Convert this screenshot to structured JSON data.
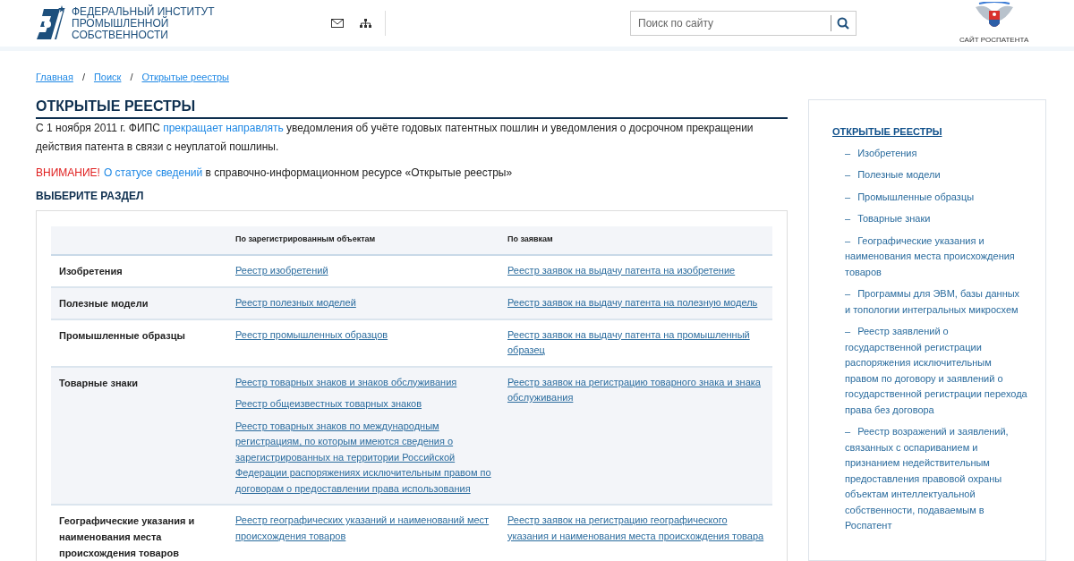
{
  "header": {
    "org_name": "ФЕДЕРАЛЬНЫЙ ИНСТИТУТ ПРОМЫШЛЕННОЙ СОБСТВЕННОСТИ",
    "search": {
      "placeholder": "Поиск по сайту"
    },
    "partner_link": "САЙТ РОСПАТЕНТА"
  },
  "breadcrumbs": [
    {
      "label": "Главная"
    },
    {
      "label": "Поиск"
    },
    {
      "label": "Открытые реестры"
    }
  ],
  "breadcrumb_separator": "/",
  "title": "ОТКРЫТЫЕ РЕЕСТРЫ",
  "notices": [
    [
      {
        "kind": "text",
        "text": "С 1 ноября 2011 г. ФИПС "
      },
      {
        "kind": "link",
        "text": "прекращает направлять"
      },
      {
        "kind": "text",
        "text": " уведомления об учёте годовых патентных пошлин и уведомления о досрочном прекращении действия патента в связи с неуплатой пошлины."
      }
    ],
    [
      {
        "kind": "alert",
        "text": "ВНИМАНИЕ!"
      },
      {
        "kind": "link",
        "text": "О статусе сведений"
      },
      {
        "kind": "text",
        "text": " в справочно-информационном ресурсе «Открытые реестры»"
      }
    ]
  ],
  "section_heading": "ВЫБЕРИТЕ РАЗДЕЛ",
  "table": {
    "columns": [
      "По зарегистрированным объектам",
      "По заявкам"
    ],
    "rows": [
      {
        "category": "Изобретения",
        "registered": [
          "Реестр изобретений"
        ],
        "applications": [
          "Реестр заявок на выдачу патента на изобретение"
        ]
      },
      {
        "category": "Полезные модели",
        "registered": [
          "Реестр полезных моделей"
        ],
        "applications": [
          "Реестр заявок на выдачу патента на полезную модель"
        ]
      },
      {
        "category": "Промышленные образцы",
        "registered": [
          "Реестр промышленных образцов"
        ],
        "applications": [
          "Реестр заявок на выдачу патента на промышленный образец"
        ]
      },
      {
        "category": "Товарные знаки",
        "registered": [
          "Реестр товарных знаков и знаков обслуживания",
          "Реестр общеизвестных товарных знаков",
          "Реестр товарных знаков по международным регистрациям, по которым имеются сведения о зарегистрированных на территории Российской Федерации распоряжениях исключительным правом по договорам о предоставлении права использования"
        ],
        "applications": [
          "Реестр заявок на регистрацию товарного знака и знака обслуживания"
        ]
      },
      {
        "category": "Географические указания и наименования места происхождения товаров",
        "registered": [
          "Реестр географических указаний и наименований мест происхождения товаров"
        ],
        "applications": [
          "Реестр заявок на регистрацию географического указания и наименования места происхождения товара"
        ]
      }
    ]
  },
  "sidebar": {
    "title": "ОТКРЫТЫЕ РЕЕСТРЫ",
    "bullet": "–",
    "items": [
      {
        "label": "Изобретения"
      },
      {
        "label": "Полезные модели"
      },
      {
        "label": "Промышленные образцы"
      },
      {
        "label": "Товарные знаки"
      },
      {
        "label": "Географические указания и наименования места происхождения товаров"
      },
      {
        "label": "Программы для ЭВМ, базы данных и топологии интегральных микросхем"
      },
      {
        "label": "Реестр заявлений о государственной регистрации распоряжения исключительным правом по договору и заявлений о государственной регистрации перехода права без договора"
      },
      {
        "label": "Реестр возражений и заявлений, связанных с оспариванием и признанием недействительным предоставления правовой охраны объектам интеллектуальной собственности, подаваемым в Роспатент"
      }
    ]
  }
}
